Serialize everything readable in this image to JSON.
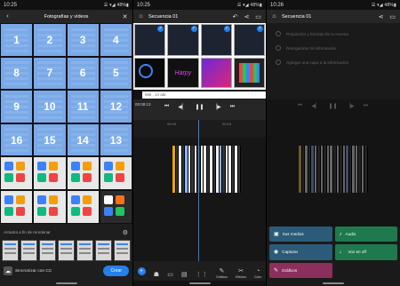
{
  "phone1": {
    "status": {
      "time": "10:25",
      "right": "☰ ▾◢ 48%▮"
    },
    "title": "Fotografías y vídeos",
    "grid": [
      {
        "n": "1",
        "sel": true
      },
      {
        "n": "2",
        "sel": true
      },
      {
        "n": "3",
        "sel": true
      },
      {
        "n": "4",
        "sel": true
      },
      {
        "n": "8",
        "sel": true
      },
      {
        "n": "7",
        "sel": true
      },
      {
        "n": "6",
        "sel": true
      },
      {
        "n": "5",
        "sel": true
      },
      {
        "n": "9",
        "sel": true
      },
      {
        "n": "10",
        "sel": true
      },
      {
        "n": "11",
        "sel": true
      },
      {
        "n": "12",
        "sel": true
      },
      {
        "n": "16",
        "sel": true
      },
      {
        "n": "15",
        "sel": true
      },
      {
        "n": "14",
        "sel": true
      },
      {
        "n": "13",
        "sel": true
      },
      {
        "n": "",
        "sel": false,
        "dark": false
      },
      {
        "n": "",
        "sel": false,
        "dark": false
      },
      {
        "n": "",
        "sel": false,
        "dark": false
      },
      {
        "n": "",
        "sel": false,
        "dark": false
      },
      {
        "n": "",
        "sel": false,
        "dark": false
      },
      {
        "n": "",
        "sel": false,
        "dark": false
      },
      {
        "n": "",
        "sel": false,
        "dark": false
      },
      {
        "n": "",
        "sel": false,
        "dark": true
      }
    ],
    "hint": "Arrastra a fin de reordenar",
    "sync_label": "Sincronizar con CC",
    "create_label": "Crear"
  },
  "phone2": {
    "status": {
      "time": "10:25",
      "right": "☰ ▾◢ 48%▮"
    },
    "title": "Secuencia 01",
    "day_label": "Mié., 14 abr.",
    "timecode": "00:08:13",
    "ruler": [
      "00:09",
      "00:19"
    ],
    "tools": [
      {
        "icon": "☗",
        "label": ""
      },
      {
        "icon": "▭",
        "label": ""
      },
      {
        "icon": "▤",
        "label": ""
      },
      {
        "icon": "⋮⋮",
        "label": ""
      },
      {
        "icon": "✎",
        "label": "Gráficos"
      },
      {
        "icon": "✂",
        "label": "Efectos"
      },
      {
        "icon": "◔",
        "label": "Color"
      }
    ]
  },
  "phone3": {
    "status": {
      "time": "10:26",
      "right": "☰ ▾◢ 48%▮"
    },
    "title": "Secuencia 01",
    "options": [
      "Proporción y formato de la escena",
      "Reorganizar mi información",
      "Agregar una capa a la información"
    ],
    "buttons": {
      "media": "Sus medios",
      "audio": "Audio",
      "capture": "Capturar",
      "voiceover": "Voz en off",
      "graphics": "Gráficos"
    }
  }
}
